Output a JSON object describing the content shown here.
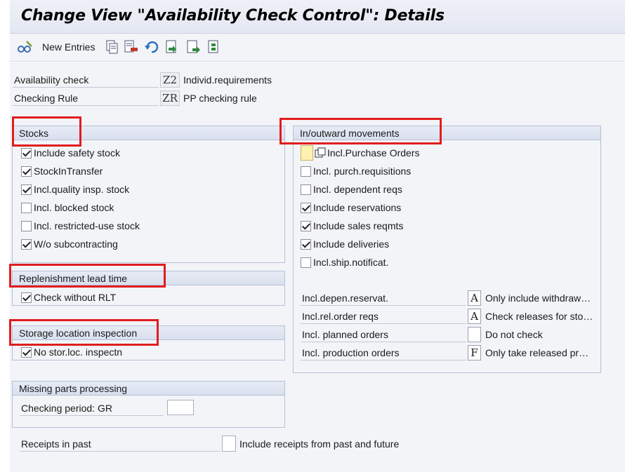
{
  "title": "Change View \"Availability Check Control\": Details",
  "toolbar": {
    "new_entries": "New Entries",
    "icons": [
      "glasses-pencil-icon",
      "copy-icon",
      "delete-icon",
      "undo-icon",
      "select-all-icon",
      "move-left-icon",
      "move-right-icon"
    ]
  },
  "header": {
    "availability_check": {
      "label": "Availability check",
      "code": "Z2",
      "text": "Individ.requirements"
    },
    "checking_rule": {
      "label": "Checking Rule",
      "code": "ZR",
      "text": "PP checking rule"
    }
  },
  "stocks": {
    "title": "Stocks",
    "items": [
      {
        "label": "Include safety stock",
        "checked": true
      },
      {
        "label": "StockInTransfer",
        "checked": true
      },
      {
        "label": "Incl.quality insp. stock",
        "checked": true
      },
      {
        "label": "Incl. blocked stock",
        "checked": false
      },
      {
        "label": "Incl. restricted-use stock",
        "checked": false
      },
      {
        "label": "W/o subcontracting",
        "checked": true
      }
    ]
  },
  "replenishment": {
    "title": "Replenishment lead time",
    "item": {
      "label": "Check without RLT",
      "checked": true
    }
  },
  "storage": {
    "title": "Storage location inspection",
    "item": {
      "label": "No stor.loc. inspectn",
      "checked": true
    }
  },
  "missing_parts": {
    "title": "Missing parts processing",
    "field_label": "Checking period: GR",
    "value": ""
  },
  "receipts": {
    "label": "Receipts in past",
    "option": "Include receipts from past and future",
    "value": ""
  },
  "movements": {
    "title": "In/outward movements",
    "items": [
      {
        "label": "Incl.Purchase Orders",
        "checked": false
      },
      {
        "label": "Incl. purch.requisitions",
        "checked": false
      },
      {
        "label": "Incl. dependent reqs",
        "checked": false
      },
      {
        "label": "Include reservations",
        "checked": true
      },
      {
        "label": "Include sales reqmts",
        "checked": true
      },
      {
        "label": "Include deliveries",
        "checked": true
      },
      {
        "label": "Incl.ship.notificat.",
        "checked": false
      }
    ],
    "selects": [
      {
        "label": "Incl.depen.reservat.",
        "code": "A",
        "text": "Only include withdraw…"
      },
      {
        "label": "Incl.rel.order reqs",
        "code": "A",
        "text": "Check releases for sto…"
      },
      {
        "label": "Incl. planned orders",
        "code": "",
        "text": "Do not check"
      },
      {
        "label": "Incl. production orders",
        "code": "F",
        "text": "Only take released pr…"
      }
    ]
  },
  "colors": {
    "highlight": "#e11d1d",
    "group_header": "#dbe2f0",
    "background": "#f2f4f8"
  }
}
